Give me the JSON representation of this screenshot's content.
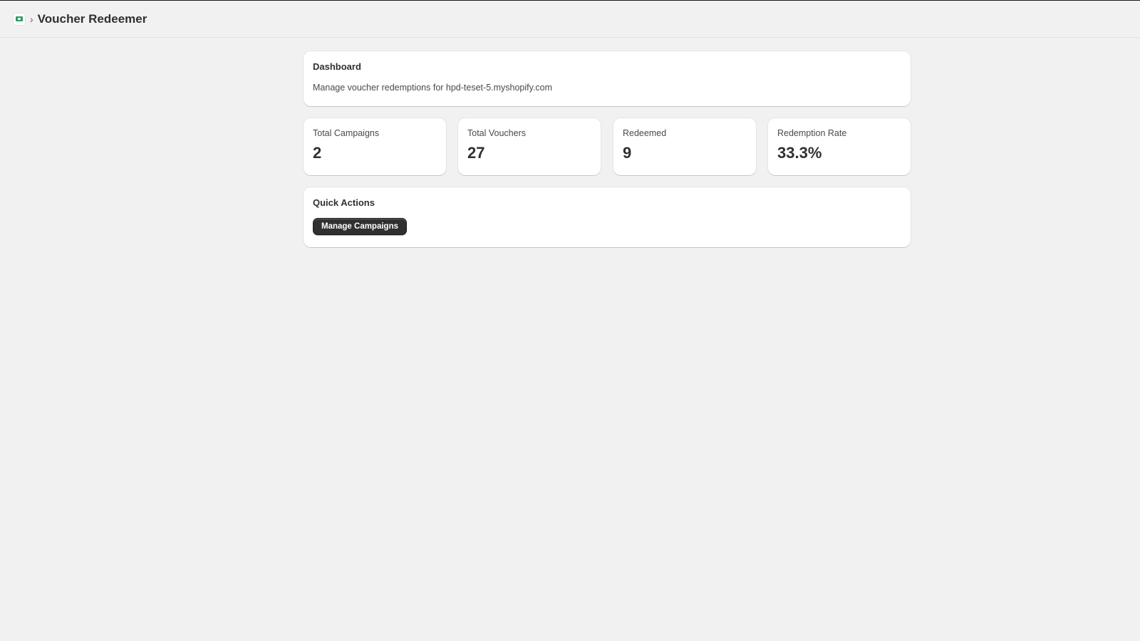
{
  "header": {
    "app_icon": "voucher-ticket-icon",
    "separator": "›",
    "title": "Voucher Redeemer"
  },
  "dashboard": {
    "title": "Dashboard",
    "description": "Manage voucher redemptions for hpd-teset-5.myshopify.com"
  },
  "stats": [
    {
      "label": "Total Campaigns",
      "value": "2"
    },
    {
      "label": "Total Vouchers",
      "value": "27"
    },
    {
      "label": "Redeemed",
      "value": "9"
    },
    {
      "label": "Redemption Rate",
      "value": "33.3%"
    }
  ],
  "quick_actions": {
    "title": "Quick Actions",
    "manage_campaigns_label": "Manage Campaigns"
  },
  "colors": {
    "background": "#f1f1f1",
    "card": "#ffffff",
    "button": "#303030",
    "icon_accent": "#2e9a6a"
  }
}
